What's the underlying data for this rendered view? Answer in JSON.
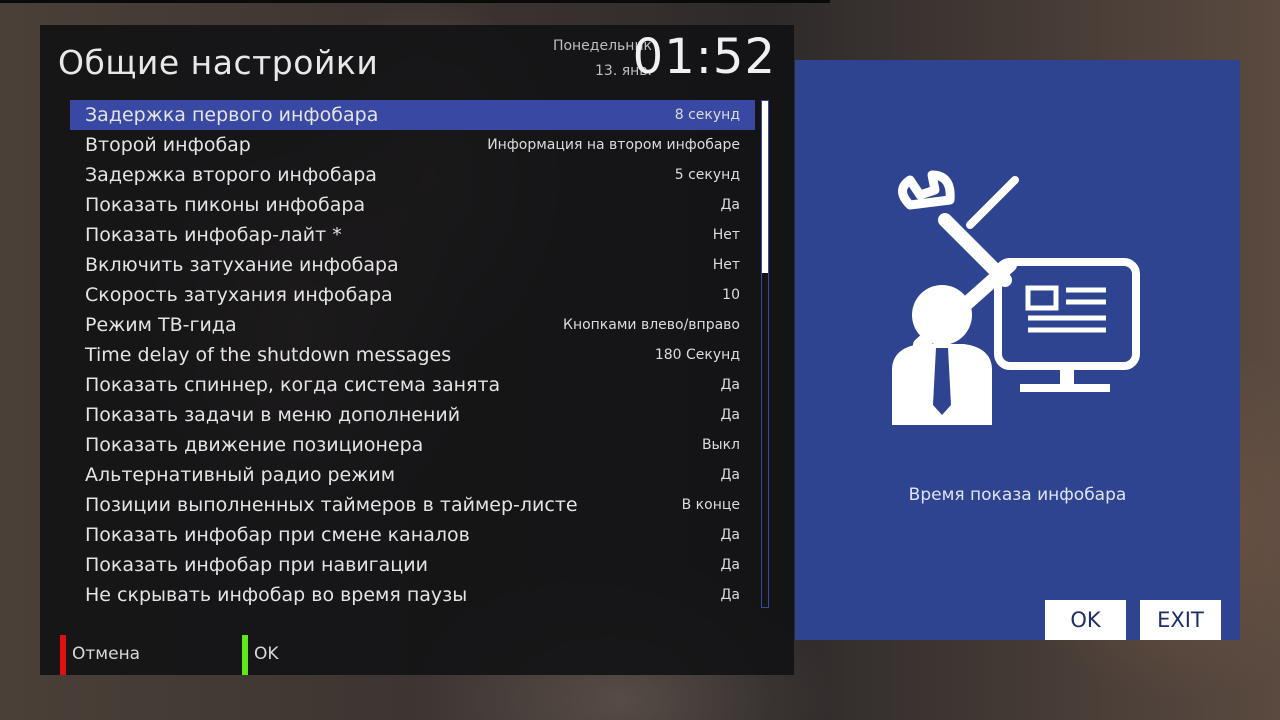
{
  "panel": {
    "title": "Общие настройки",
    "day": "Понедельник",
    "date": "13. янв.",
    "time": "01:52"
  },
  "settings": [
    {
      "label": "Задержка первого инфобара",
      "value": "8 секунд",
      "selected": true
    },
    {
      "label": "Второй инфобар",
      "value": "Информация на втором инфобаре"
    },
    {
      "label": "Задержка второго инфобара",
      "value": "5 секунд"
    },
    {
      "label": "Показать пиконы инфобара",
      "value": "Да"
    },
    {
      "label": "Показать инфобар-лайт *",
      "value": "Нет"
    },
    {
      "label": "Включить затухание инфобара",
      "value": "Нет"
    },
    {
      "label": "Скорость затухания инфобара",
      "value": "10"
    },
    {
      "label": "Режим ТВ-гида",
      "value": "Кнопками влево/вправо"
    },
    {
      "label": "Time delay of the shutdown messages",
      "value": "180 Секунд"
    },
    {
      "label": "Показать спиннер, когда система занята",
      "value": "Да"
    },
    {
      "label": "Показать задачи в меню дополнений",
      "value": "Да"
    },
    {
      "label": "Показать движение позиционера",
      "value": "Выкл"
    },
    {
      "label": "Альтернативный радио режим",
      "value": "Да"
    },
    {
      "label": "Позиции выполненных таймеров в таймер-листе",
      "value": "В конце"
    },
    {
      "label": "Показать инфобар при смене каналов",
      "value": "Да"
    },
    {
      "label": "Показать инфобар при навигации",
      "value": "Да"
    },
    {
      "label": "Не скрывать инфобар во время паузы",
      "value": "Да"
    }
  ],
  "keys": {
    "red_label": "Отмена",
    "green_label": "OK",
    "red_color": "#e01010",
    "green_color": "#5ee81a"
  },
  "info": {
    "description": "Время показа инфобара",
    "illustration_icon": "settings-user-computer-icon",
    "ok_label": "OK",
    "exit_label": "EXIT"
  },
  "colors": {
    "highlight": "#3949a3",
    "info_panel": "#2f4490"
  }
}
